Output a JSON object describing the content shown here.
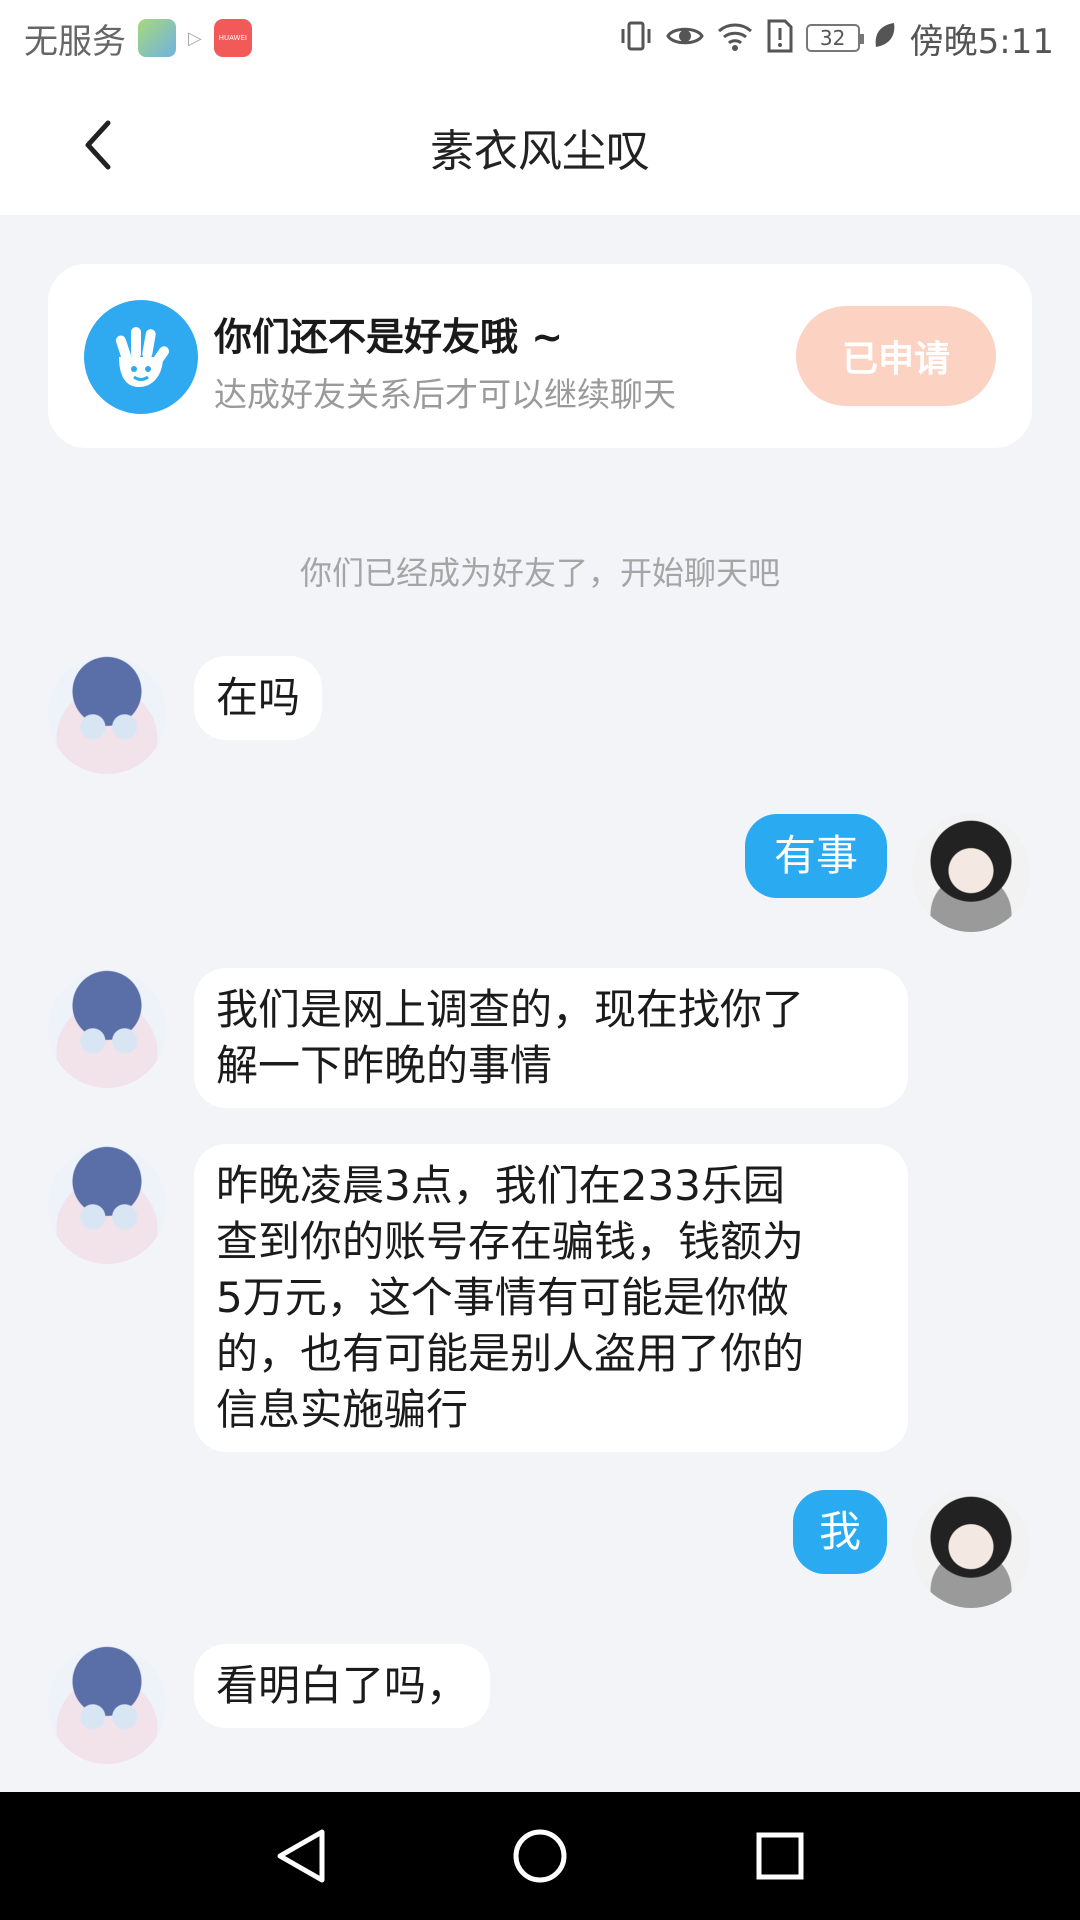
{
  "status_bar": {
    "carrier": "无服务",
    "battery": "32",
    "time": "傍晚5:11",
    "huawei_label": "HUAWEI",
    "icons": [
      "vibrate-icon",
      "eye-icon",
      "wifi-icon",
      "sim-alert-icon",
      "battery-icon",
      "leaf-icon"
    ]
  },
  "header": {
    "title": "素衣风尘叹",
    "back_icon": "chevron-left-icon"
  },
  "friend_card": {
    "title": "你们还不是好友哦 ~",
    "subtitle": "达成好友关系后才可以继续聊天",
    "button_label": "已申请",
    "icon": "hand-icon",
    "accent_color": "#2fa9f0",
    "button_color": "#fcd2c2"
  },
  "system_notice": "你们已经成为好友了，开始聊天吧",
  "messages": [
    {
      "side": "in",
      "lines": [
        "在吗"
      ]
    },
    {
      "side": "out",
      "lines": [
        "有事"
      ]
    },
    {
      "side": "in",
      "lines": [
        "我们是网上调查的，现在找你了",
        "解一下昨晚的事情"
      ]
    },
    {
      "side": "in",
      "lines": [
        "昨晚凌晨3点，我们在233乐园",
        "查到你的账号存在骗钱，钱额为",
        "5万元，这个事情有可能是你做",
        "的，也有可能是别人盗用了你的",
        "信息实施骗行"
      ]
    },
    {
      "side": "out",
      "lines": [
        "我"
      ]
    },
    {
      "side": "in",
      "lines": [
        "看明白了吗，"
      ]
    }
  ],
  "colors": {
    "outgoing_bubble": "#2aaaf1",
    "incoming_bubble": "#ffffff",
    "background": "#f3f4f8"
  },
  "nav": {
    "back": "triangle-back-icon",
    "home": "circle-home-icon",
    "recents": "square-recents-icon"
  }
}
